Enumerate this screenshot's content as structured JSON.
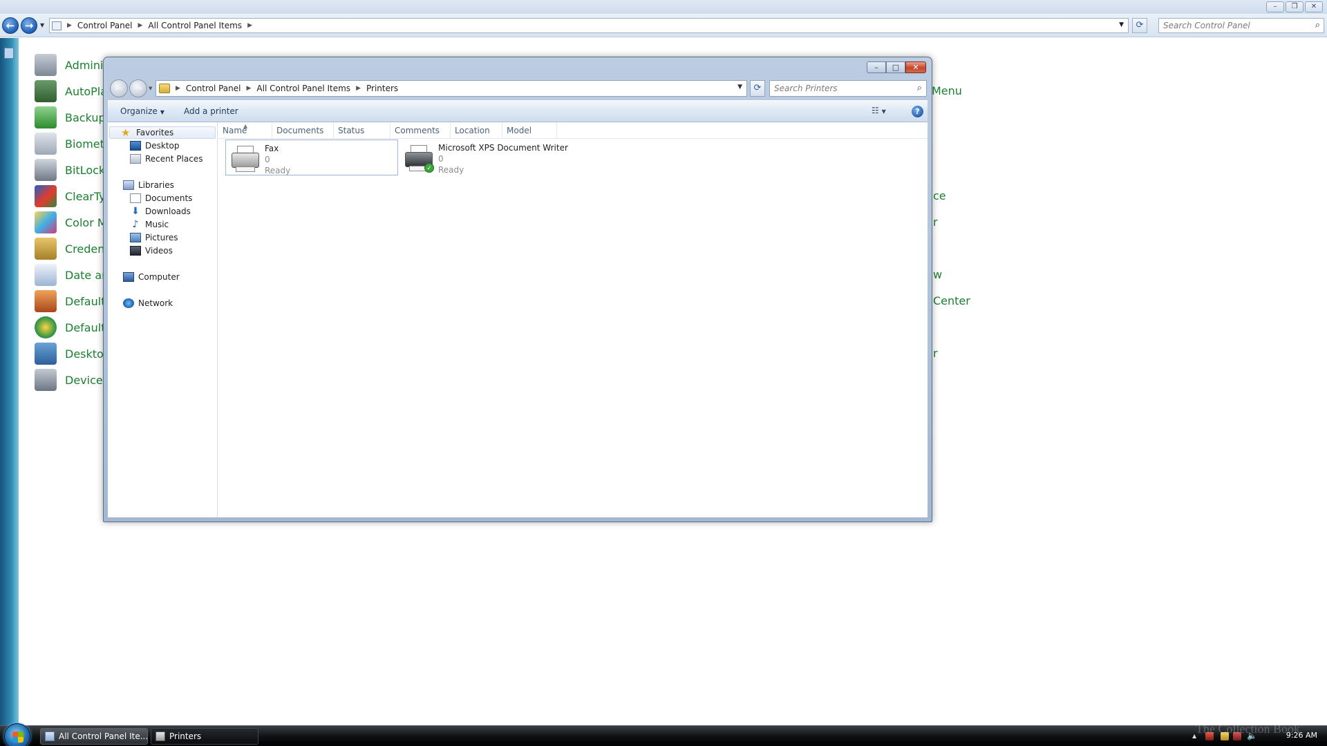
{
  "background_window": {
    "breadcrumb": [
      "Control Panel",
      "All Control Panel Items"
    ],
    "search_placeholder": "Search Control Panel",
    "items_left": [
      "Adminis",
      "AutoPla",
      "Backup",
      "Biometr",
      "BitLocke",
      "ClearTyp",
      "Color M",
      "Credent",
      "Date an",
      "Default",
      "Default",
      "Desktop",
      "Device M"
    ],
    "items_right": [
      "Menu",
      "ce",
      "r",
      "w",
      "Center",
      "r"
    ]
  },
  "window": {
    "breadcrumb": [
      "Control Panel",
      "All Control Panel Items",
      "Printers"
    ],
    "search_placeholder": "Search Printers",
    "commands": {
      "organize": "Organize",
      "add_printer": "Add a printer"
    },
    "nav": {
      "favorites": "Favorites",
      "desktop": "Desktop",
      "recent_places": "Recent Places",
      "libraries": "Libraries",
      "documents": "Documents",
      "downloads": "Downloads",
      "music": "Music",
      "pictures": "Pictures",
      "videos": "Videos",
      "computer": "Computer",
      "network": "Network"
    },
    "columns": [
      "Name",
      "Documents",
      "Status",
      "Comments",
      "Location",
      "Model"
    ],
    "printers": [
      {
        "name": "Fax",
        "documents": "0",
        "status": "Ready"
      },
      {
        "name": "Microsoft XPS Document Writer",
        "documents": "0",
        "status": "Ready"
      }
    ]
  },
  "taskbar": {
    "buttons": [
      "All Control Panel Ite...",
      "Printers"
    ],
    "clock": "9:26 AM",
    "watermark": "The Collection Book"
  },
  "icons": {
    "back": "back-arrow-icon",
    "forward": "forward-arrow-icon",
    "search": "magnifier-icon",
    "refresh": "refresh-icon",
    "help": "help-icon",
    "favorites": "star-icon",
    "printer": "printer-icon",
    "default_printer": "checkmark-icon"
  }
}
